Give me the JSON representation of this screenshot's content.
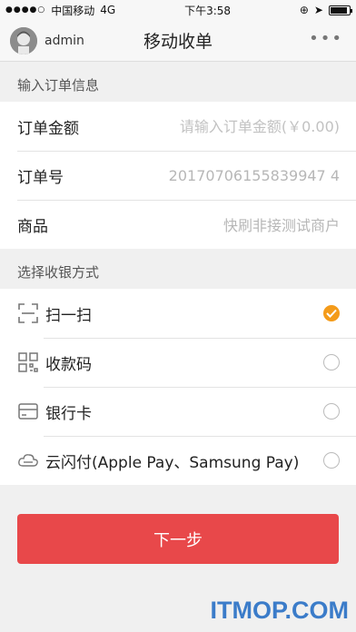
{
  "status_bar": {
    "carrier": "中国移动",
    "network": "4G",
    "time": "下午3:58",
    "battery_level": 0.9
  },
  "nav": {
    "username": "admin",
    "title": "移动收单",
    "more_icon": "more-icon"
  },
  "order_section": {
    "label": "输入订单信息",
    "amount": {
      "label": "订单金额",
      "placeholder": "请输入订单金额(￥0.00)"
    },
    "order_no": {
      "label": "订单号",
      "value": "20170706155839947 4"
    },
    "merchant": {
      "label": "商品",
      "value": "快刷非接测试商户"
    }
  },
  "payment_section": {
    "label": "选择收银方式",
    "methods": [
      {
        "label": "扫一扫",
        "icon": "scan-icon",
        "selected": true
      },
      {
        "label": "收款码",
        "icon": "qr-code-icon",
        "selected": false
      },
      {
        "label": "银行卡",
        "icon": "bank-card-icon",
        "selected": false
      },
      {
        "label": "云闪付(Apple Pay、Samsung Pay)",
        "icon": "cloud-pay-icon",
        "selected": false
      }
    ],
    "accent_color": "#f49b1a"
  },
  "next_button": {
    "label": "下一步",
    "color": "#e8484a"
  },
  "watermark": "ITMOP.COM"
}
